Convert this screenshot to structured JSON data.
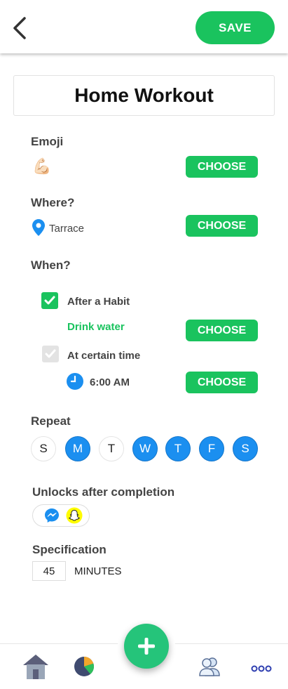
{
  "header": {
    "back_icon": "chevron-left-icon",
    "save_label": "SAVE"
  },
  "habit": {
    "title": "Home Workout"
  },
  "emoji_section": {
    "label": "Emoji",
    "value": "💪🏻",
    "choose_label": "CHOOSE"
  },
  "where_section": {
    "label": "Where?",
    "place": "Tarrace",
    "choose_label": "CHOOSE"
  },
  "when_section": {
    "label": "When?",
    "after_habit": {
      "label": "After a Habit",
      "checked": true,
      "habit_name": "Drink water",
      "choose_label": "CHOOSE"
    },
    "certain_time": {
      "label": "At certain time",
      "checked": false,
      "time": "6:00 AM",
      "choose_label": "CHOOSE"
    }
  },
  "repeat_section": {
    "label": "Repeat",
    "days": [
      {
        "letter": "S",
        "selected": false
      },
      {
        "letter": "M",
        "selected": true
      },
      {
        "letter": "T",
        "selected": false
      },
      {
        "letter": "W",
        "selected": true
      },
      {
        "letter": "T",
        "selected": true
      },
      {
        "letter": "F",
        "selected": true
      },
      {
        "letter": "S",
        "selected": true
      }
    ]
  },
  "unlocks_section": {
    "label": "Unlocks after completion",
    "apps": [
      "messenger-icon",
      "snapchat-icon"
    ]
  },
  "specification_section": {
    "label": "Specification",
    "value": "45",
    "unit": "MINUTES"
  },
  "bottom_nav": {
    "items": [
      "home-icon",
      "pie-chart-icon",
      "add-icon",
      "users-icon",
      "more-icon"
    ]
  },
  "colors": {
    "green": "#1ac35e",
    "blue": "#1b8ff0",
    "fab": "#25c47a"
  }
}
